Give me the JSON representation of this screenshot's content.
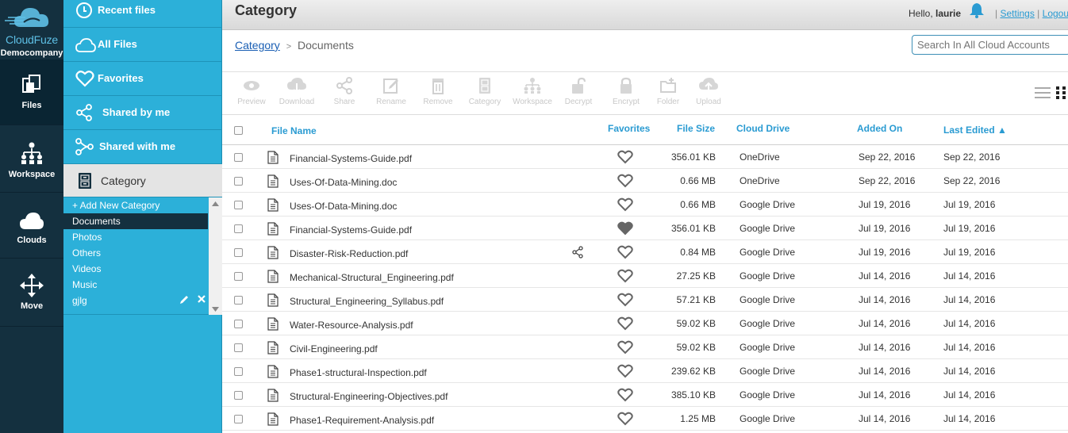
{
  "brand": {
    "name": "CloudFuze",
    "company": "Democompany"
  },
  "rail": [
    {
      "label": "Files",
      "icon": "files-icon"
    },
    {
      "label": "Workspace",
      "icon": "workspace-icon"
    },
    {
      "label": "Clouds",
      "icon": "cloud-icon"
    },
    {
      "label": "Move",
      "icon": "move-icon"
    }
  ],
  "sidebar": {
    "items": [
      {
        "label": "Recent files",
        "icon": "clock-icon"
      },
      {
        "label": "All Files",
        "icon": "cloud-outline-icon"
      },
      {
        "label": "Favorites",
        "icon": "heart-icon"
      },
      {
        "label": "Shared by me",
        "icon": "share-icon"
      },
      {
        "label": "Shared with me",
        "icon": "share-in-icon"
      },
      {
        "label": "Category",
        "icon": "cabinet-icon"
      }
    ],
    "categories": [
      "+ Add New Category",
      "Documents",
      "Photos",
      "Others",
      "Videos",
      "Music",
      "gjlg"
    ],
    "selected_category": "Documents"
  },
  "header": {
    "title": "Category",
    "hello": "Hello,",
    "user": "laurie",
    "settings": "Settings",
    "logout": "Logout",
    "divider": "|"
  },
  "breadcrumb": {
    "root": "Category",
    "separator": ">",
    "current": "Documents"
  },
  "search": {
    "placeholder": "Search In All Cloud Accounts"
  },
  "toolbar": [
    "Preview",
    "Download",
    "Share",
    "Rename",
    "Remove",
    "Category",
    "Workspace",
    "Decrypt",
    "Encrypt",
    "Folder",
    "Upload"
  ],
  "table": {
    "columns": [
      "File Name",
      "Favorites",
      "File Size",
      "Cloud Drive",
      "Added On",
      "Last Edited ▲"
    ],
    "rows": [
      {
        "name": "Financial-Systems-Guide.pdf",
        "size": "356.01 KB",
        "drive": "OneDrive",
        "added": "Sep 22, 2016",
        "edited": "Sep 22, 2016",
        "fav": false,
        "shared": false
      },
      {
        "name": "Uses-Of-Data-Mining.doc",
        "size": "0.66 MB",
        "drive": "OneDrive",
        "added": "Sep 22, 2016",
        "edited": "Sep 22, 2016",
        "fav": false,
        "shared": false
      },
      {
        "name": "Uses-Of-Data-Mining.doc",
        "size": "0.66 MB",
        "drive": "Google Drive",
        "added": "Jul 19, 2016",
        "edited": "Jul 19, 2016",
        "fav": false,
        "shared": false
      },
      {
        "name": "Financial-Systems-Guide.pdf",
        "size": "356.01 KB",
        "drive": "Google Drive",
        "added": "Jul 19, 2016",
        "edited": "Jul 19, 2016",
        "fav": true,
        "shared": false
      },
      {
        "name": "Disaster-Risk-Reduction.pdf",
        "size": "0.84 MB",
        "drive": "Google Drive",
        "added": "Jul 19, 2016",
        "edited": "Jul 19, 2016",
        "fav": false,
        "shared": true
      },
      {
        "name": "Mechanical-Structural_Engineering.pdf",
        "size": "27.25 KB",
        "drive": "Google Drive",
        "added": "Jul 14, 2016",
        "edited": "Jul 14, 2016",
        "fav": false,
        "shared": false
      },
      {
        "name": "Structural_Engineering_Syllabus.pdf",
        "size": "57.21 KB",
        "drive": "Google Drive",
        "added": "Jul 14, 2016",
        "edited": "Jul 14, 2016",
        "fav": false,
        "shared": false
      },
      {
        "name": "Water-Resource-Analysis.pdf",
        "size": "59.02 KB",
        "drive": "Google Drive",
        "added": "Jul 14, 2016",
        "edited": "Jul 14, 2016",
        "fav": false,
        "shared": false
      },
      {
        "name": "Civil-Engineering.pdf",
        "size": "59.02 KB",
        "drive": "Google Drive",
        "added": "Jul 14, 2016",
        "edited": "Jul 14, 2016",
        "fav": false,
        "shared": false
      },
      {
        "name": "Phase1-structural-Inspection.pdf",
        "size": "239.62 KB",
        "drive": "Google Drive",
        "added": "Jul 14, 2016",
        "edited": "Jul 14, 2016",
        "fav": false,
        "shared": false
      },
      {
        "name": "Structural-Engineering-Objectives.pdf",
        "size": "385.10 KB",
        "drive": "Google Drive",
        "added": "Jul 14, 2016",
        "edited": "Jul 14, 2016",
        "fav": false,
        "shared": false
      },
      {
        "name": "Phase1-Requirement-Analysis.pdf",
        "size": "1.25 MB",
        "drive": "Google Drive",
        "added": "Jul 14, 2016",
        "edited": "Jul 14, 2016",
        "fav": false,
        "shared": false
      }
    ]
  },
  "colors": {
    "rail": "#14303f",
    "sidebar": "#2cb0d9",
    "accent": "#2a9bd2"
  }
}
